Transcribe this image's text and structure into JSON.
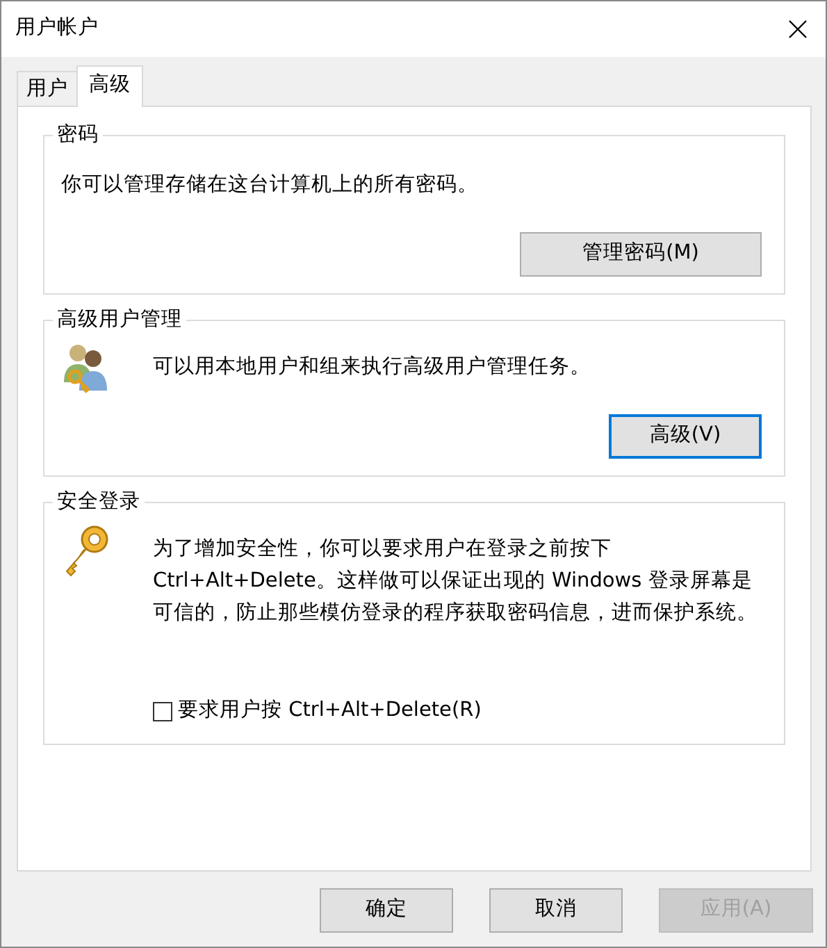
{
  "window": {
    "title": "用户帐户"
  },
  "tabs": [
    {
      "label": "用户",
      "selected": false
    },
    {
      "label": "高级",
      "selected": true
    }
  ],
  "groups": [
    {
      "kind": "plain",
      "title": "密码",
      "text": "你可以管理存储在这台计算机上的所有密码。",
      "button": {
        "label": "管理密码(M)",
        "default": false
      }
    },
    {
      "kind": "users",
      "title": "高级用户管理",
      "text": "可以用本地用户和组来执行高级用户管理任务。",
      "button": {
        "label": "高级(V)",
        "default": true
      }
    },
    {
      "kind": "key",
      "title": "安全登录",
      "text": "为了增加安全性，你可以要求用户在登录之前按下 Ctrl+Alt+Delete。这样做可以保证出现的 Windows 登录屏幕是可信的，防止那些模仿登录的程序获取密码信息，进而保护系统。",
      "checkbox": {
        "label": "要求用户按 Ctrl+Alt+Delete(R)",
        "checked": false
      }
    }
  ],
  "buttons": [
    {
      "label": "确定",
      "disabled": false
    },
    {
      "label": "取消",
      "disabled": false
    },
    {
      "label": "应用(A)",
      "disabled": true
    }
  ]
}
